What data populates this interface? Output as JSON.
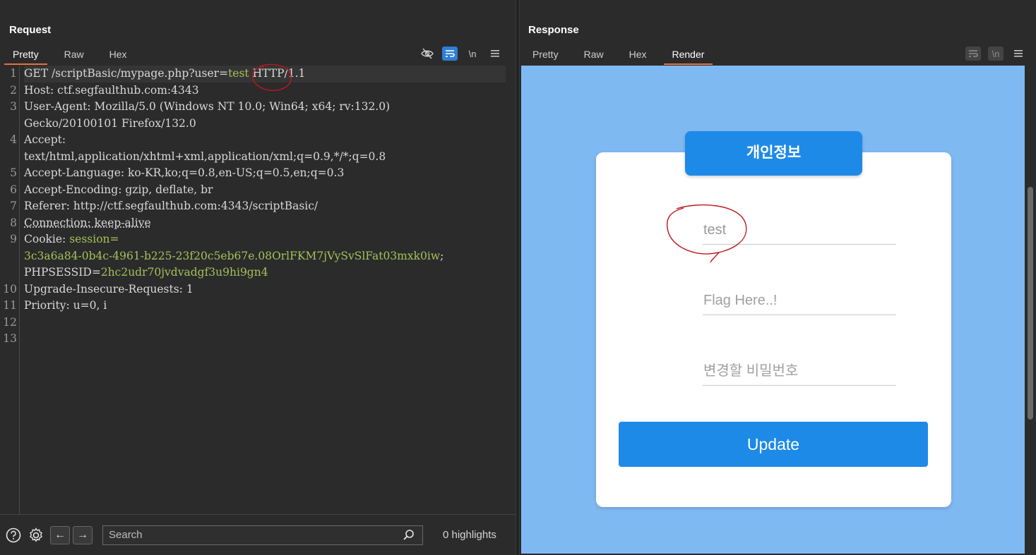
{
  "layout_buttons": [
    "split-horizontal",
    "split-vertical",
    "single"
  ],
  "request": {
    "title": "Request",
    "tabs": [
      {
        "label": "Pretty",
        "active": true
      },
      {
        "label": "Raw",
        "active": false
      },
      {
        "label": "Hex",
        "active": false
      }
    ],
    "tools": {
      "newline_label": "\\n"
    },
    "lines": [
      {
        "n": "1",
        "segments": [
          [
            "k",
            "GET /scriptBasic/mypage.php?user="
          ],
          [
            "v",
            "test"
          ],
          [
            "k",
            " HTTP/1.1"
          ]
        ]
      },
      {
        "n": "2",
        "segments": [
          [
            "k",
            "Host: ctf.segfaulthub.com:4343"
          ]
        ]
      },
      {
        "n": "3",
        "segments": [
          [
            "k",
            "User-Agent: Mozilla/5.0 (Windows NT 10.0; Win64; x64; rv:132.0)"
          ]
        ]
      },
      {
        "n": "",
        "segments": [
          [
            "k",
            "Gecko/20100101 Firefox/132.0"
          ]
        ]
      },
      {
        "n": "4",
        "segments": [
          [
            "k",
            "Accept:"
          ]
        ]
      },
      {
        "n": "",
        "segments": [
          [
            "k",
            "text/html,application/xhtml+xml,application/xml;q=0.9,*/*;q=0.8"
          ]
        ]
      },
      {
        "n": "5",
        "segments": [
          [
            "k",
            "Accept-Language: ko-KR,ko;q=0.8,en-US;q=0.5,en;q=0.3"
          ]
        ]
      },
      {
        "n": "6",
        "segments": [
          [
            "k",
            "Accept-Encoding: gzip, deflate, br"
          ]
        ]
      },
      {
        "n": "7",
        "segments": [
          [
            "k",
            "Referer: http://ctf.segfaulthub.com:4343/scriptBasic/"
          ]
        ]
      },
      {
        "n": "8",
        "segments": [
          [
            "ul",
            "Connection: keep-alive"
          ]
        ]
      },
      {
        "n": "9",
        "segments": [
          [
            "k",
            "Cookie: "
          ],
          [
            "v",
            "session="
          ]
        ]
      },
      {
        "n": "",
        "segments": [
          [
            "v",
            "3c3a6a84-0b4c-4961-b225-23f20c5eb67e.08OrlFKM7jVySvSlFat03mxk0iw"
          ],
          [
            "k",
            ";"
          ]
        ]
      },
      {
        "n": "",
        "segments": [
          [
            "k",
            "PHPSESSID="
          ],
          [
            "v",
            "2hc2udr70jvdvadgf3u9hi9gn4"
          ]
        ]
      },
      {
        "n": "10",
        "segments": [
          [
            "k",
            "Upgrade-Insecure-Requests: 1"
          ]
        ]
      },
      {
        "n": "11",
        "segments": [
          [
            "k",
            "Priority: u=0, i"
          ]
        ]
      },
      {
        "n": "12",
        "segments": []
      },
      {
        "n": "13",
        "segments": []
      }
    ],
    "search": {
      "placeholder": "Search",
      "value": ""
    },
    "highlights": "0 highlights"
  },
  "response": {
    "title": "Response",
    "tabs": [
      {
        "label": "Pretty",
        "active": false
      },
      {
        "label": "Raw",
        "active": false
      },
      {
        "label": "Hex",
        "active": false
      },
      {
        "label": "Render",
        "active": true
      }
    ],
    "tools": {
      "newline_label": "\\n"
    },
    "render": {
      "card_title": "개인정보",
      "fields": [
        {
          "value": "test",
          "placeholder": ""
        },
        {
          "value": "",
          "placeholder": "Flag Here..!"
        },
        {
          "value": "",
          "placeholder": "변경할 비밀번호"
        }
      ],
      "button_label": "Update"
    }
  },
  "colors": {
    "accent_tab": "#e8713c",
    "toggle_on": "#2e7fd6",
    "value_green": "#a7c05a",
    "render_bg": "#7fb9f2",
    "form_button": "#1e8ae8"
  }
}
